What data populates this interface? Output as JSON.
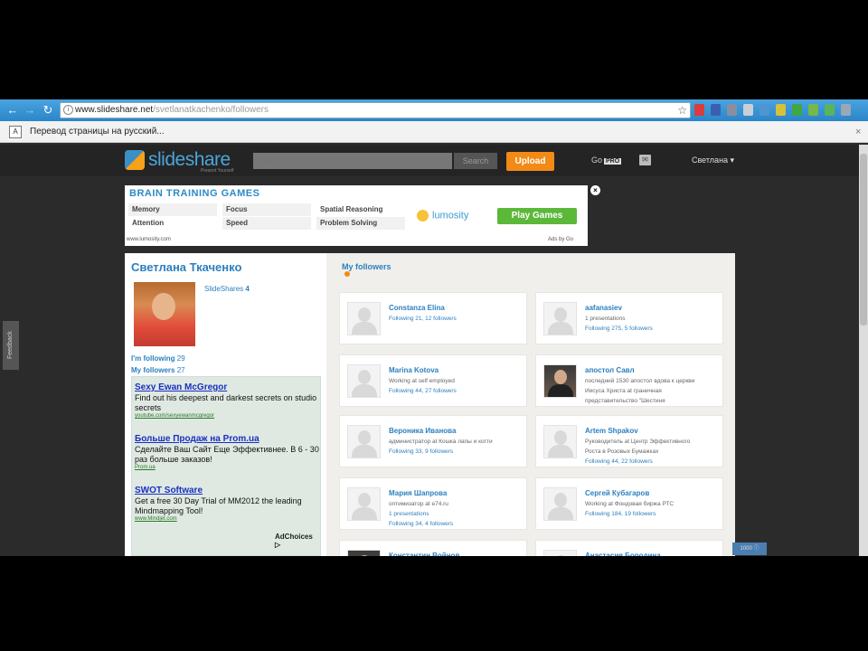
{
  "browser": {
    "url_host": "www.slideshare.net",
    "url_path": "/svetlanatkachenko/followers",
    "translate_text": "Перевод страницы на русский...",
    "translate_close": "×"
  },
  "header": {
    "logo": "slideshare",
    "logo_tagline": "Present Yourself",
    "search_placeholder": "Search",
    "search_button": "Search",
    "upload_button": "Upload",
    "go_label": "Go",
    "pro_badge": "PRO",
    "user_menu": "Светлана ▾"
  },
  "ad_banner": {
    "title": "BRAIN TRAINING GAMES",
    "cells": [
      "Memory",
      "Focus",
      "Spatial Reasoning",
      "Attention",
      "Speed",
      "Problem Solving"
    ],
    "brand": "lumosity",
    "cta": "Play Games",
    "url": "www.lumosity.com",
    "ad_choice": "Ads by Go",
    "close": "×"
  },
  "profile": {
    "name": "Светлана Ткаченко",
    "slideshares_label": "SlideShares",
    "slideshares_count": "4",
    "following_label": "I'm following",
    "following_count": "29",
    "followers_label": "My followers",
    "followers_count": "27"
  },
  "google_ads": [
    {
      "title": "Sexy Ewan McGregor",
      "body": "Find out his deepest and darkest secrets on studio secrets",
      "url": "youtube.com/sexyewanmcgregor"
    },
    {
      "title": "Больше Продаж на Prom.ua",
      "body": "Сделайте Ваш Сайт Еще Эффективнее. В 6 - 30 раз больше заказов!",
      "url": "Prom.ua"
    },
    {
      "title": "SWOT Software",
      "body": "Get a free 30 Day Trial of MM2012 the leading Mindmapping Tool!",
      "url": "www.Mindjet.com"
    }
  ],
  "adchoices": "AdChoices ▷",
  "followers": {
    "heading": "My followers",
    "cards": [
      {
        "name": "Constanza Elina",
        "lines": [
          "Following 21, 12 followers"
        ],
        "blue": [
          true
        ],
        "photo": false
      },
      {
        "name": "aafanasiev",
        "lines": [
          "1 presentations",
          "Following 275, 5 followers"
        ],
        "blue": [
          false,
          true
        ],
        "photo": false
      },
      {
        "name": "Marina Kotova",
        "lines": [
          "Working at self employed",
          "Following 44, 27 followers"
        ],
        "blue": [
          false,
          true
        ],
        "photo": false
      },
      {
        "name": "апостол Савл",
        "lines": [
          "последний 1530 апостол вдова к церкви",
          "Иисуса Христа at граничная",
          "представительство \"Шестиня"
        ],
        "blue": [
          false,
          false,
          false
        ],
        "photo": true
      },
      {
        "name": "Вероника Иванова",
        "lines": [
          "администратор at Кошка лапы и когти",
          "Following 33, 9 followers"
        ],
        "blue": [
          false,
          true
        ],
        "photo": false
      },
      {
        "name": "Artem Shpakov",
        "lines": [
          "Руководитель at Центр Эффективного",
          "Роста в Розовых Бумажках",
          "Following 44, 22 followers"
        ],
        "blue": [
          false,
          false,
          true
        ],
        "photo": false
      },
      {
        "name": "Мария Шапрова",
        "lines": [
          "оптимизатор at e74.ru",
          "1 presentations",
          "Following 34, 4 followers"
        ],
        "blue": [
          false,
          true,
          true
        ],
        "photo": false
      },
      {
        "name": "Сергей Кубагаров",
        "lines": [
          "Working at Фондовая биржа РТС",
          "Following 184, 19 followers"
        ],
        "blue": [
          false,
          true
        ],
        "photo": false
      },
      {
        "name": "Константин Войнов",
        "lines": [],
        "blue": [],
        "photo": true
      },
      {
        "name": "Анастасия Бородина",
        "lines": [],
        "blue": [],
        "photo": false
      }
    ]
  },
  "feedback": "Feedback",
  "mini_widget": "1000 ⓘ",
  "colors": {
    "accent": "#2c7fbf",
    "upload": "#f28a16",
    "cta": "#5bb839"
  }
}
